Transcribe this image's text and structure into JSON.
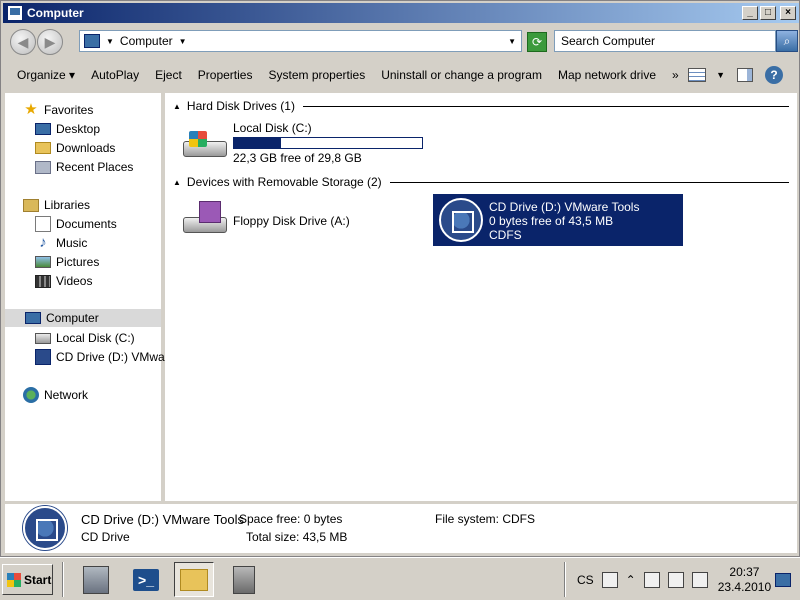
{
  "window": {
    "title": "Computer"
  },
  "address": {
    "crumb": "Computer",
    "search_placeholder": "Search Computer"
  },
  "toolbar": {
    "organize": "Organize",
    "autoplay": "AutoPlay",
    "eject": "Eject",
    "properties": "Properties",
    "system_properties": "System properties",
    "uninstall": "Uninstall or change a program",
    "map_drive": "Map network drive",
    "more": "»"
  },
  "nav": {
    "favorites": "Favorites",
    "desktop": "Desktop",
    "downloads": "Downloads",
    "recent": "Recent Places",
    "libraries": "Libraries",
    "documents": "Documents",
    "music": "Music",
    "pictures": "Pictures",
    "videos": "Videos",
    "computer": "Computer",
    "local_disk": "Local Disk (C:)",
    "cd_drive": "CD Drive (D:) VMware",
    "network": "Network"
  },
  "content": {
    "hdd_group": "Hard Disk Drives (1)",
    "removable_group": "Devices with Removable Storage (2)",
    "c_drive": {
      "name": "Local Disk (C:)",
      "free": "22,3 GB free of 29,8 GB",
      "used_fraction": 0.25
    },
    "floppy": {
      "name": "Floppy Disk Drive (A:)"
    },
    "cd": {
      "name": "CD Drive (D:) VMware Tools",
      "free": "0 bytes free of 43,5 MB",
      "fs": "CDFS"
    }
  },
  "details": {
    "name": "CD Drive (D:) VMware Tools",
    "type": "CD Drive",
    "space_free": "Space free: 0 bytes",
    "total_size": "Total size: 43,5 MB",
    "file_system": "File system: CDFS"
  },
  "taskbar": {
    "start": "Start",
    "lang": "CS",
    "time": "20:37",
    "date": "23.4.2010"
  }
}
